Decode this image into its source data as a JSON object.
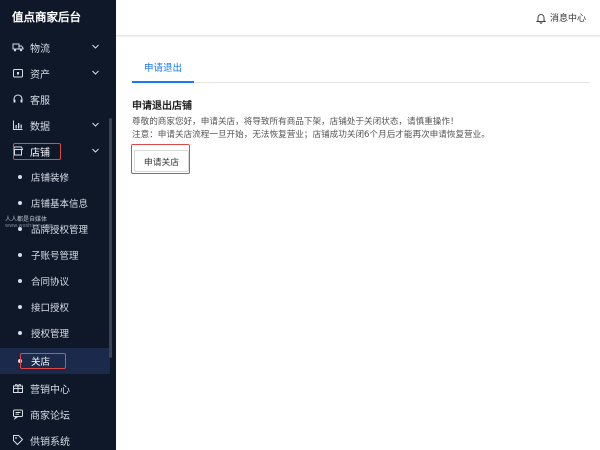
{
  "sidebar": {
    "title": "值点商家后台",
    "menu": [
      {
        "label": "物流",
        "icon": "truck-icon",
        "chevron": true
      },
      {
        "label": "资产",
        "icon": "wallet-icon",
        "chevron": true
      },
      {
        "label": "客服",
        "icon": "headset-icon",
        "chevron": false
      },
      {
        "label": "数据",
        "icon": "bar-chart-icon",
        "chevron": true
      },
      {
        "label": "店铺",
        "icon": "store-icon",
        "chevron": true
      }
    ],
    "store_sub": [
      {
        "label": "店铺装修"
      },
      {
        "label": "店铺基本信息"
      },
      {
        "label": "品牌授权管理"
      },
      {
        "label": "子账号管理"
      },
      {
        "label": "合同协议"
      },
      {
        "label": "接口授权"
      },
      {
        "label": "授权管理"
      },
      {
        "label": "关店"
      }
    ],
    "bottom_menu": [
      {
        "label": "营销中心",
        "icon": "gift-icon"
      },
      {
        "label": "商家论坛",
        "icon": "forum-icon"
      },
      {
        "label": "供销系统",
        "icon": "tag-icon"
      }
    ],
    "watermark_line1": "人人都是自媒体",
    "watermark_line2": "www.woshipm.com"
  },
  "topbar": {
    "notify_label": "消息中心"
  },
  "content": {
    "tab_label": "申请退出",
    "section_title": "申请退出店铺",
    "desc_line1": "尊敬的商家您好，申请关店，将导致所有商品下架，店铺处于关闭状态，请慎重操作！",
    "desc_line2": "注意：申请关店流程一旦开始，无法恢复营业；店铺成功关闭6个月后才能再次申请恢复营业。",
    "button_label": "申请关店"
  },
  "colors": {
    "sidebar_bg": "#0e1829",
    "accent": "#1677ff",
    "highlight_box": "#e0484a"
  }
}
